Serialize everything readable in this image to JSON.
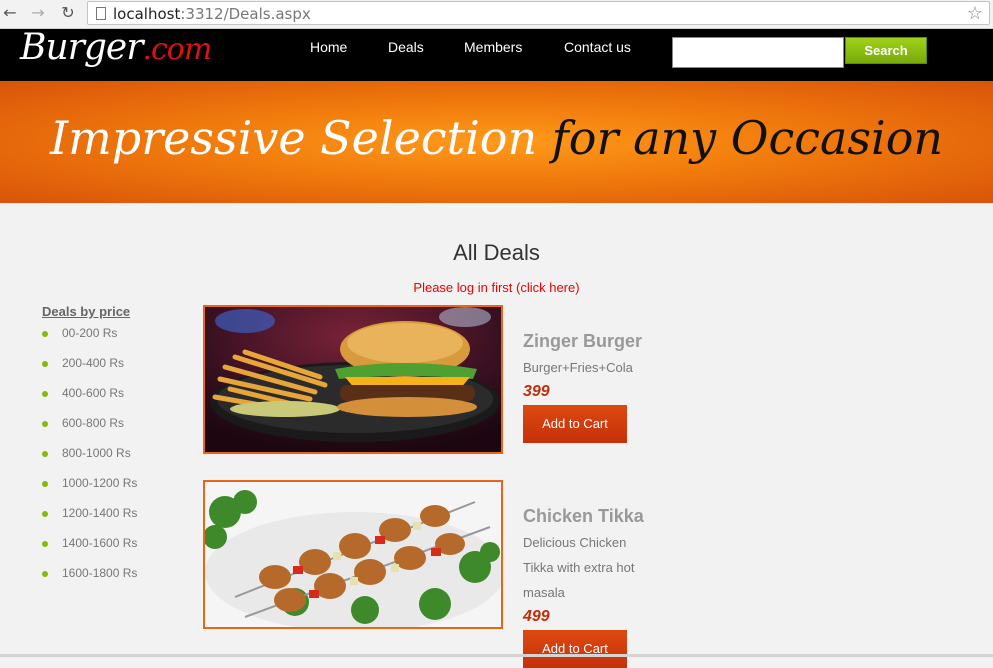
{
  "browser": {
    "url_host": "localhost",
    "url_rest": ":3312/Deals.aspx"
  },
  "header": {
    "logo_main": "Burger",
    "logo_suffix": ".com",
    "menu": {
      "home": "Home",
      "deals": "Deals",
      "members": "Members",
      "contact": "Contact us"
    },
    "search_value": "",
    "search_button": "Search"
  },
  "banner": {
    "text_white": "Impressive Selection",
    "text_black": "for any Occasion"
  },
  "main": {
    "title": "All Deals",
    "login_notice": "Please log in first (click here)"
  },
  "sidebar": {
    "title": "Deals by price",
    "items": [
      "00-200 Rs",
      "200-400 Rs",
      "400-600 Rs",
      "600-800 Rs",
      "800-1000 Rs",
      "1000-1200 Rs",
      "1200-1400 Rs",
      "1400-1600 Rs",
      "1600-1800 Rs"
    ]
  },
  "deals": [
    {
      "name": "Zinger Burger",
      "description": "Burger+Fries+Cola",
      "price": "399",
      "button": "Add to Cart"
    },
    {
      "name": "Chicken Tikka",
      "description": "Delicious Chicken Tikka with extra hot masala",
      "price": "499",
      "button": "Add to Cart"
    }
  ],
  "colors": {
    "accent_orange": "#e8651a",
    "price_red": "#c12e0a",
    "search_green": "#86b80d"
  }
}
